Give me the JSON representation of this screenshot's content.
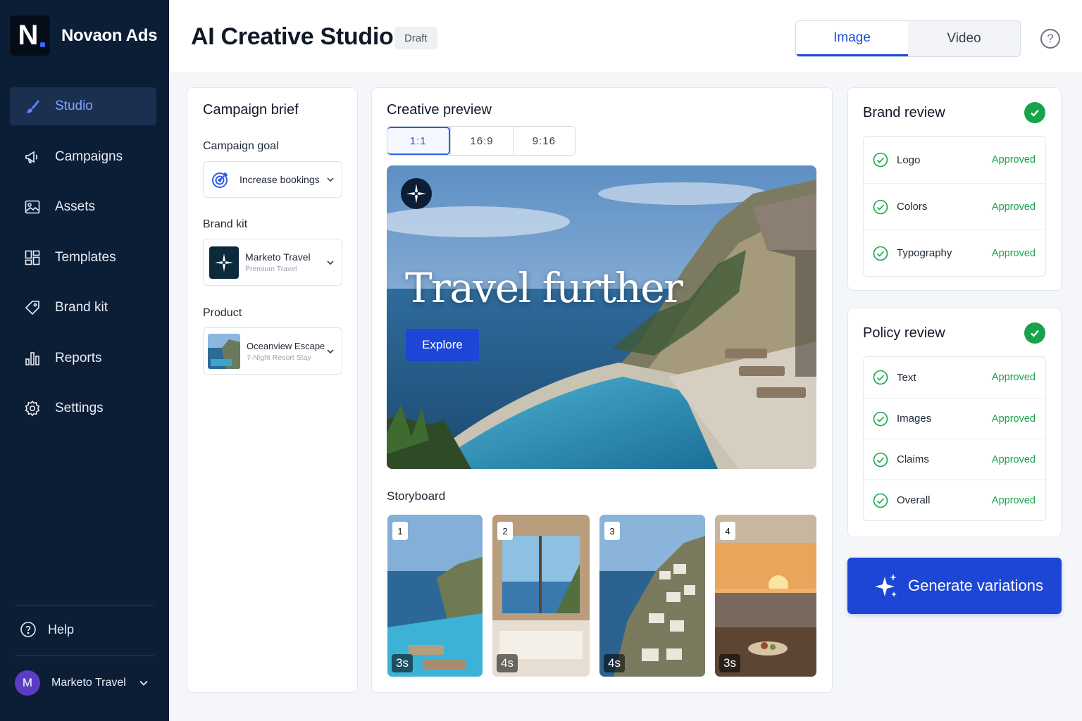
{
  "brand": {
    "logo_letter": "N",
    "name": "Novaon Ads"
  },
  "nav": [
    {
      "label": "Studio",
      "icon": "brush-icon",
      "active": true
    },
    {
      "label": "Campaigns",
      "icon": "megaphone-icon"
    },
    {
      "label": "Assets",
      "icon": "image-icon"
    },
    {
      "label": "Templates",
      "icon": "grid-icon"
    },
    {
      "label": "Brand kit",
      "icon": "tag-icon"
    },
    {
      "label": "Reports",
      "icon": "bar-chart-icon"
    },
    {
      "label": "Settings",
      "icon": "gear-icon"
    }
  ],
  "help": {
    "label": "Help"
  },
  "account": {
    "initial": "M",
    "name": "Marketo Travel"
  },
  "header": {
    "title": "AI Creative Studio",
    "status_badge": "Draft",
    "mode_tabs": [
      {
        "label": "Image",
        "active": true
      },
      {
        "label": "Video"
      }
    ],
    "help_symbol": "?"
  },
  "brief": {
    "title": "Campaign brief",
    "goal_label": "Campaign goal",
    "goal_value": "Increase bookings",
    "brand_kit_label": "Brand kit",
    "brand_kit_name": "Marketo Travel",
    "brand_kit_sub": "Premium Travel",
    "product_label": "Product",
    "product_name": "Oceanview Escape",
    "product_sub": "7-Night Resort Stay"
  },
  "preview": {
    "title": "Creative preview",
    "ratios": [
      {
        "label": "1:1",
        "active": true
      },
      {
        "label": "16:9"
      },
      {
        "label": "9:16"
      }
    ],
    "headline": "Travel further",
    "cta": "Explore",
    "storyboard_label": "Storyboard",
    "frames": [
      {
        "num": "1",
        "duration": "3s"
      },
      {
        "num": "2",
        "duration": "4s"
      },
      {
        "num": "3",
        "duration": "4s"
      },
      {
        "num": "4",
        "duration": "3s"
      }
    ]
  },
  "brand_review": {
    "title": "Brand review",
    "items": [
      {
        "name": "Logo",
        "status": "Approved"
      },
      {
        "name": "Colors",
        "status": "Approved"
      },
      {
        "name": "Typography",
        "status": "Approved"
      }
    ]
  },
  "policy_review": {
    "title": "Policy review",
    "items": [
      {
        "name": "Text",
        "status": "Approved"
      },
      {
        "name": "Images",
        "status": "Approved"
      },
      {
        "name": "Claims",
        "status": "Approved"
      },
      {
        "name": "Overall",
        "status": "Approved"
      }
    ]
  },
  "generate": {
    "label": "Generate variations"
  },
  "colors": {
    "sidebar": "#0c1d36",
    "accent": "#1d46d6",
    "approved": "#16a34a"
  }
}
